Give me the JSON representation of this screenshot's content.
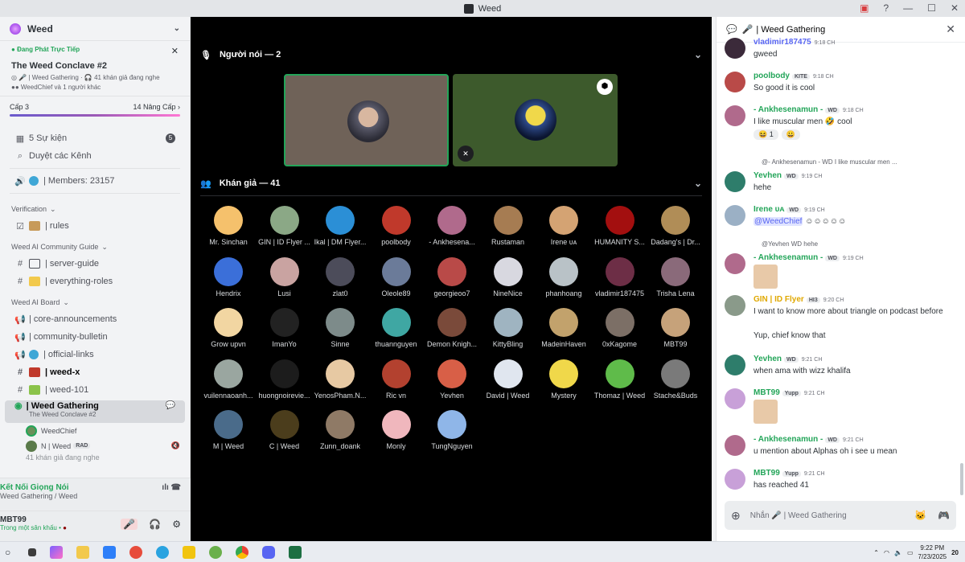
{
  "window": {
    "title": "Weed"
  },
  "sidebar": {
    "server_name": "Weed",
    "event": {
      "live_label": "Đang Phát Trực Tiếp",
      "title": "The Weed Conclave #2",
      "channel": "| Weed Gathering",
      "listeners": "41 khán giả đang nghe",
      "hosts": "WeedChief và 1 người khác"
    },
    "level": {
      "label": "Cấp 3",
      "boosts": "14 Nâng Cấp ›"
    },
    "events": {
      "label": "5 Sự kiện",
      "count": "5"
    },
    "browse": "Duyệt các Kênh",
    "members": "| Members: 23157",
    "categories": [
      {
        "name": "Verification",
        "channels": [
          "| rules"
        ]
      },
      {
        "name": "Weed AI Community Guide",
        "channels": [
          "| server-guide",
          "| everything-roles"
        ]
      },
      {
        "name": "Weed AI Board",
        "channels": [
          "| core-announcements",
          "| community-bulletin",
          "| official-links",
          "| weed-x",
          "| weed-101"
        ]
      }
    ],
    "active_stage": {
      "name": "| Weed Gathering",
      "topic": "The Weed Conclave #2"
    },
    "stage_users": [
      {
        "name": "WeedChief"
      },
      {
        "name": "N | Weed",
        "tag": "RAD"
      }
    ],
    "listener_cut": "41 khán giả đang nghe"
  },
  "voice": {
    "status": "Kết Nối Giọng Nói",
    "location": "Weed Gathering / Weed",
    "user": "MBT99",
    "user_status": "Trong một sân khấu •"
  },
  "stage": {
    "speakers_label": "Người nói — 2",
    "audience_label": "Khán giả — 41",
    "audience": [
      "Mr. Sinchan",
      "GIN | ID Flyer ...",
      "Ikal | DM Flyer...",
      "poolbody",
      "- Ankhesena...",
      "Rustaman",
      "Irene ᴜᴀ",
      "HUMANITY S...",
      "Dadang's | Dr...",
      "Hendrix",
      "Lusi",
      "zlat0",
      "Oleole89",
      "georgieoo7",
      "NineNice",
      "phanhoang",
      "vladimir187475",
      "Trisha Lena",
      "Grow upvn",
      "ImanYo",
      "Sinne",
      "thuannguyen",
      "Demon Knigh...",
      "KittyBling",
      "MadeinHaven",
      "0xKagome",
      "MBT99",
      "vuilennaoanh...",
      "huongnoirevie...",
      "YenosPham.N...",
      "Ric vn",
      "Yevhen",
      "David | Weed",
      "Mystery",
      "Thomaz | Weed",
      "Stache&Buds",
      "M | Weed",
      "C | Weed",
      "Zunn_doank",
      "Monly",
      "TungNguyen"
    ],
    "audience_colors": [
      "#f5c16c",
      "#8ba886",
      "#2b8fd6",
      "#c0392b",
      "#b06a8c",
      "#a67c52",
      "#d4a373",
      "#a30f0f",
      "#b08d57",
      "#3b6fd9",
      "#c9a3a1",
      "#4c4c5a",
      "#6b7b99",
      "#b94a48",
      "#d8d8e0",
      "#b9c2c7",
      "#6d2e46",
      "#8a6a7a",
      "#f2d6a2",
      "#222222",
      "#7d8b8a",
      "#3fa7a3",
      "#7a4a3a",
      "#9fb4c1",
      "#c2a26c",
      "#7c6f66",
      "#c6a27a",
      "#9aa6a0",
      "#1c1c1c",
      "#e7c9a3",
      "#b3412f",
      "#d85f47",
      "#e0e6ef",
      "#f0d84a",
      "#5fbb4a",
      "#7a7a7a",
      "#4a6b8a",
      "#4b3d1c",
      "#8f7a66",
      "#f0b7bd",
      "#8fb6e8"
    ]
  },
  "chat": {
    "header": "| Weed Gathering",
    "messages": [
      {
        "name": "vladimir187475",
        "time": "9:18 CH",
        "text": "gweed",
        "color": "#5865f2"
      },
      {
        "name": "poolbody",
        "tag": "KITE",
        "time": "9:18 CH",
        "text": "So good it is cool",
        "color": "#23a559"
      },
      {
        "name": "- Ankhesenamun -",
        "tag": "WD",
        "time": "9:18 CH",
        "text": "I like muscular men 🤣 cool",
        "color": "#23a559",
        "reactions": [
          "😆 1",
          "😀"
        ]
      },
      {
        "reply": "@- Ankhesenamun -  WD  I like muscular men ...",
        "name": "Yevhen",
        "tag": "WD",
        "time": "9:19 CH",
        "text": "hehe",
        "color": "#23a559"
      },
      {
        "name": "Irene ᴜᴀ",
        "tag": "WD",
        "time": "9:19 CH",
        "mention": "@WeedChief",
        "text": "☺☺☺☺☺",
        "color": "#23a559"
      },
      {
        "reply": "@Yevhen  WD  hehe",
        "name": "- Ankhesenamun -",
        "tag": "WD",
        "time": "9:19 CH",
        "text": "",
        "color": "#23a559"
      },
      {
        "name": "GIN | ID Flyer",
        "tag": "HI3",
        "time": "9:20 CH",
        "text": "I want to know more about triangle on podcast before",
        "text2": "Yup, chief know that",
        "color": "#e0a800"
      },
      {
        "name": "Yevhen",
        "tag": "WD",
        "time": "9:21 CH",
        "text": "when ama with wizz khalifa",
        "color": "#23a559"
      },
      {
        "name": "MBT99",
        "tag": "Yupp",
        "time": "9:21 CH",
        "text": "",
        "color": "#23a559"
      },
      {
        "name": "- Ankhesenamun -",
        "tag": "WD",
        "time": "9:21 CH",
        "text": "u mention about Alphas oh i see u mean",
        "color": "#23a559"
      },
      {
        "name": "MBT99",
        "tag": "Yupp",
        "time": "9:21 CH",
        "text": "has reached 41",
        "color": "#23a559"
      }
    ],
    "input_placeholder": "Nhắn 🎤 | Weed Gathering"
  },
  "taskbar": {
    "time": "9:22 PM",
    "date": "7/23/2025",
    "notif": "20"
  }
}
